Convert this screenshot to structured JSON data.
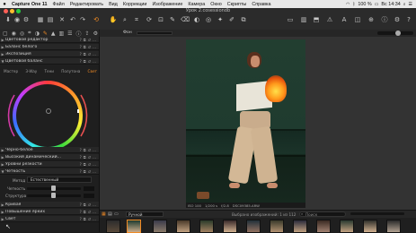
{
  "menubar": {
    "app": "Capture One 11",
    "items": [
      "Файл",
      "Редактировать",
      "Вид",
      "Коррекции",
      "Изображение",
      "Камера",
      "Окно",
      "Скрипты",
      "Справка"
    ],
    "battery": "100 %",
    "clock": "Вс 14:34"
  },
  "window": {
    "title": "Урок 2.cosessiondb"
  },
  "viewer": {
    "zoom_label": "Фон"
  },
  "left_panel": {
    "tools_top": [
      "Цветовой редактор",
      "Баланс белого",
      "Экспозиция",
      "Цветовой баланс"
    ],
    "color_balance_tabs": [
      "Мастер",
      "3-Way",
      "Тени",
      "Полутона",
      "Свет"
    ],
    "tools_bottom": [
      "Черно-белое",
      "Высокий динамический...",
      "Уровни резкости",
      "Четкость"
    ],
    "clarity": {
      "method_label": "Метод",
      "method_value": "Естественный",
      "clarity_label": "Четкость",
      "structure_label": "Структура"
    },
    "tools_last": [
      "Кривая",
      "Повышение ярких",
      "Свет"
    ]
  },
  "photo": {
    "iso": "ISO 100",
    "shutter": "1/200 s",
    "aperture": "f/2.8",
    "filename": "DSC09385.ARW"
  },
  "filmstrip": {
    "sort_label": "Ручной",
    "status": "Выбрано изображений: 1 из 112",
    "search_placeholder": "Поиск"
  },
  "colors": {
    "accent": "#f08a24",
    "panel": "#1f1f1f",
    "wall": "#223e30"
  }
}
